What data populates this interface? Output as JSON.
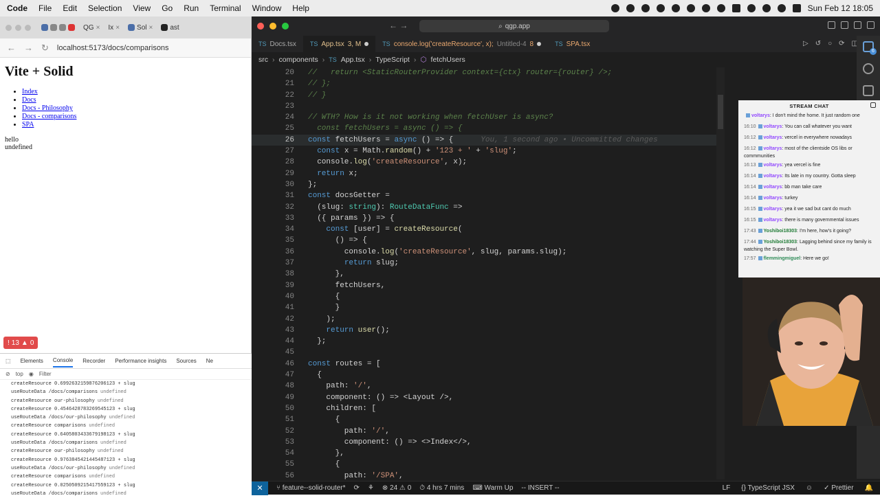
{
  "menubar": {
    "app": "Code",
    "items": [
      "File",
      "Edit",
      "Selection",
      "View",
      "Go",
      "Run",
      "Terminal",
      "Window",
      "Help"
    ],
    "clock": "Sun Feb 12  18:05"
  },
  "browser": {
    "tabs": [
      "QG",
      "Ix",
      "Sol",
      "ast"
    ],
    "url": "localhost:5173/docs/comparisons",
    "heading": "Vite + Solid",
    "links": [
      "Index",
      "Docs",
      "Docs - Philosophy",
      "Docs - comparisons",
      "SPA"
    ],
    "body_lines": [
      "hello",
      "undefined"
    ],
    "error_badge": "13",
    "warn_count": "0"
  },
  "devtools": {
    "tabs": [
      "Elements",
      "Console",
      "Recorder",
      "Performance insights",
      "Sources",
      "Ne"
    ],
    "active_tab": "Console",
    "context": "top",
    "filter_placeholder": "Filter",
    "lines": [
      {
        "text": "createResource 0.6992632159876206123 + slug",
        "suffix": ""
      },
      {
        "text": "useRouteData /docs/comparisons",
        "suffix": "undefined"
      },
      {
        "text": "createResource our-philosophy",
        "suffix": "undefined"
      },
      {
        "text": "createResource 0.4546428783269545123 + slug",
        "suffix": ""
      },
      {
        "text": "useRouteData /docs/our-philosophy",
        "suffix": "undefined"
      },
      {
        "text": "createResource comparisons",
        "suffix": "undefined"
      },
      {
        "text": "createResource 0.6405803433679198123 + slug",
        "suffix": ""
      },
      {
        "text": "useRouteData /docs/comparisons",
        "suffix": "undefined"
      },
      {
        "text": "createResource our-philosophy",
        "suffix": "undefined"
      },
      {
        "text": "createResource 0.9763845421445487123 + slug",
        "suffix": ""
      },
      {
        "text": "useRouteData /docs/our-philosophy",
        "suffix": "undefined"
      },
      {
        "text": "createResource comparisons",
        "suffix": "undefined"
      },
      {
        "text": "createResource 0.0250509215417559123 + slug",
        "suffix": ""
      },
      {
        "text": "useRouteData /docs/comparisons",
        "suffix": "undefined"
      }
    ]
  },
  "vscode": {
    "search": "qgp.app",
    "tabs": [
      {
        "label": "Docs.tsx",
        "icon": "TS"
      },
      {
        "label": "App.tsx",
        "icon": "TS",
        "badge": "3, M"
      },
      {
        "label": "console.log('createResource', x);",
        "icon": "TS",
        "extra": "Untitled-4",
        "badge2": "8"
      },
      {
        "label": "SPA.tsx",
        "icon": "TS"
      }
    ],
    "breadcrumbs": [
      "src",
      "components",
      "App.tsx",
      "TypeScript",
      "fetchUsers"
    ],
    "blame": "You, 1 second ago • Uncommitted changes",
    "status": {
      "branch": "feature--solid-router*",
      "problems": "24",
      "warnings": "0",
      "time": "4 hrs 7 mins",
      "warmup": "Warm Up",
      "mode": "-- INSERT --",
      "eol": "LF",
      "lang": "TypeScript JSX",
      "formatter": "Prettier"
    },
    "lines": [
      {
        "n": "20",
        "t": "//   return <StaticRouterProvider context={ctx} router={router} />;"
      },
      {
        "n": "21",
        "t": "// };"
      },
      {
        "n": "22",
        "t": "// }"
      },
      {
        "n": "23",
        "t": ""
      },
      {
        "n": "24",
        "t": "// WTH? How is it not working when fetchUser is async?"
      },
      {
        "n": "25",
        "t": "  const fetchUsers = async () => {"
      },
      {
        "n": "26",
        "t": "const fetchUsers = async () => {"
      },
      {
        "n": "27",
        "t": "  const x = Math.random() + '123 + ' + 'slug';"
      },
      {
        "n": "28",
        "t": "  console.log('createResource', x);"
      },
      {
        "n": "29",
        "t": "  return x;"
      },
      {
        "n": "30",
        "t": "};"
      },
      {
        "n": "31",
        "t": "const docsGetter ="
      },
      {
        "n": "32",
        "t": "  (slug: string): RouteDataFunc =>"
      },
      {
        "n": "33",
        "t": "  ({ params }) => {"
      },
      {
        "n": "34",
        "t": "    const [user] = createResource("
      },
      {
        "n": "35",
        "t": "      () => {"
      },
      {
        "n": "36",
        "t": "        console.log('createResource', slug, params.slug);"
      },
      {
        "n": "37",
        "t": "        return slug;"
      },
      {
        "n": "38",
        "t": "      },"
      },
      {
        "n": "39",
        "t": "      fetchUsers,"
      },
      {
        "n": "40",
        "t": "      {"
      },
      {
        "n": "41",
        "t": "      }"
      },
      {
        "n": "42",
        "t": "    );"
      },
      {
        "n": "43",
        "t": "    return user();"
      },
      {
        "n": "44",
        "t": "  };"
      },
      {
        "n": "45",
        "t": ""
      },
      {
        "n": "46",
        "t": "const routes = ["
      },
      {
        "n": "47",
        "t": "  {"
      },
      {
        "n": "48",
        "t": "    path: '/',"
      },
      {
        "n": "49",
        "t": "    component: () => <Layout />,"
      },
      {
        "n": "50",
        "t": "    children: ["
      },
      {
        "n": "51",
        "t": "      {"
      },
      {
        "n": "52",
        "t": "        path: '/',"
      },
      {
        "n": "53",
        "t": "        component: () => <>Index</>,"
      },
      {
        "n": "54",
        "t": "      },"
      },
      {
        "n": "55",
        "t": "      {"
      },
      {
        "n": "56",
        "t": "        path: '/SPA',"
      }
    ]
  },
  "chat": {
    "title": "STREAM CHAT",
    "messages": [
      {
        "time": "",
        "user": "voltarys",
        "text": "I don't mind the home. It just random one"
      },
      {
        "time": "16:10",
        "user": "voltarys",
        "text": "You can call whatever you want"
      },
      {
        "time": "16:12",
        "user": "voltarys",
        "text": "vercel in everywhere nowadays"
      },
      {
        "time": "16:12",
        "user": "voltarys",
        "text": "most of the clientside OS libs or commmunities"
      },
      {
        "time": "16:13",
        "user": "voltarys",
        "text": "yea vercel is fine"
      },
      {
        "time": "16:14",
        "user": "voltarys",
        "text": "Its late in my country. Gotta sleep"
      },
      {
        "time": "16:14",
        "user": "voltarys",
        "text": "bb man take care"
      },
      {
        "time": "16:14",
        "user": "voltarys",
        "text": "turkey"
      },
      {
        "time": "16:15",
        "user": "voltarys",
        "text": "yea it we sad but cant do much"
      },
      {
        "time": "16:15",
        "user": "voltarys",
        "text": "there is many governmental issues"
      },
      {
        "time": "17:43",
        "user": "Yoshiboi18303",
        "text": "I'm here, how's it going?"
      },
      {
        "time": "17:44",
        "user": "Yoshiboi18303",
        "text": "Lagging behind since my family is watching the Super Bowl."
      },
      {
        "time": "17:57",
        "user": "flemmingmiguel",
        "text": "Here we go!"
      }
    ]
  },
  "colors": {
    "editor_bg": "#1e1e1e",
    "accent": "#0e639c",
    "error": "#e14b4b"
  }
}
